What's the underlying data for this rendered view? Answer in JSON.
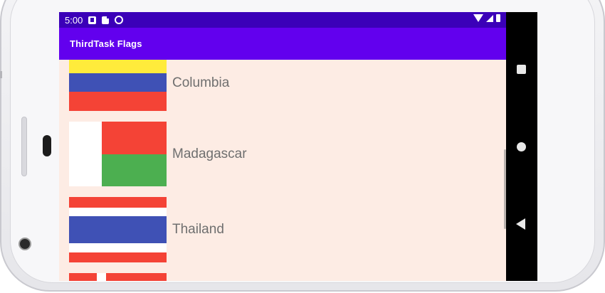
{
  "status_bar": {
    "time": "5:00",
    "icons": [
      "a-notification-icon",
      "sd-card-icon",
      "sync-icon",
      "wifi-icon",
      "signal-icon",
      "battery-icon"
    ]
  },
  "app_bar": {
    "title": "ThirdTask Flags"
  },
  "countries": [
    {
      "name": "Columbia",
      "flag_colors": [
        "#ffeb3b",
        "#3f51b5",
        "#f44336"
      ]
    },
    {
      "name": "Madagascar",
      "flag_colors": [
        "#ffffff",
        "#f44336",
        "#4caf50"
      ]
    },
    {
      "name": "Thailand",
      "flag_colors": [
        "#f44336",
        "#ffffff",
        "#3f51b5"
      ]
    }
  ],
  "nav_bar": {
    "buttons": [
      "recents-icon",
      "home-icon",
      "back-icon"
    ]
  },
  "colors": {
    "status_bar": "#3b00b8",
    "app_bar": "#6200ee",
    "list_background": "#fdece4",
    "label_text": "#6f6f6f"
  }
}
